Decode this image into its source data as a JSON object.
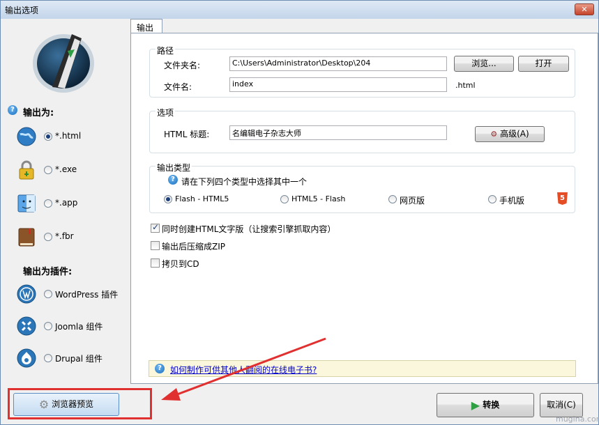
{
  "window": {
    "title": "输出选项",
    "close": "✕"
  },
  "left": {
    "output_as": "输出为:",
    "formats": [
      {
        "label": "*.html",
        "icon": "globe-icon",
        "selected": true
      },
      {
        "label": "*.exe",
        "icon": "lock-icon",
        "selected": false
      },
      {
        "label": "*.app",
        "icon": "finder-icon",
        "selected": false
      },
      {
        "label": "*.fbr",
        "icon": "book-icon",
        "selected": false
      }
    ],
    "plugins_as": "输出为插件:",
    "plugins": [
      {
        "label": "WordPress 插件",
        "icon": "wordpress-icon",
        "selected": false
      },
      {
        "label": "Joomla 组件",
        "icon": "joomla-icon",
        "selected": false
      },
      {
        "label": "Drupal 组件",
        "icon": "drupal-icon",
        "selected": false
      }
    ]
  },
  "tab": {
    "label": "输出"
  },
  "path": {
    "group": "路径",
    "folder_label": "文件夹名:",
    "folder_value": "C:\\Users\\Administrator\\Desktop\\204",
    "browse": "浏览...",
    "open": "打开",
    "file_label": "文件名:",
    "file_value": "index",
    "ext": ".html"
  },
  "options": {
    "group": "选项",
    "title_label": "HTML 标题:",
    "title_value": "名编辑电子杂志大师",
    "advanced": "高级(A)"
  },
  "type": {
    "group": "输出类型",
    "hint": "请在下列四个类型中选择其中一个",
    "choices": [
      {
        "label": "Flash - HTML5",
        "selected": true
      },
      {
        "label": "HTML5 - Flash",
        "selected": false
      },
      {
        "label": "网页版",
        "selected": false
      },
      {
        "label": "手机版",
        "selected": false
      }
    ],
    "html5_badge": "5"
  },
  "checks": [
    {
      "label": "同时创建HTML文字版（让搜索引擎抓取内容）",
      "checked": true
    },
    {
      "label": "输出后压缩成ZIP",
      "checked": false
    },
    {
      "label": "拷贝到CD",
      "checked": false
    }
  ],
  "help": {
    "text": "如何制作可供其他人翻阅的在线电子书?"
  },
  "bottom": {
    "preview": "浏览器预览",
    "convert": "转换",
    "cancel": "取消(C)"
  },
  "watermark": "mugina.com",
  "colors": {
    "accent": "#1a6fc1",
    "highlight": "#e0302f"
  }
}
